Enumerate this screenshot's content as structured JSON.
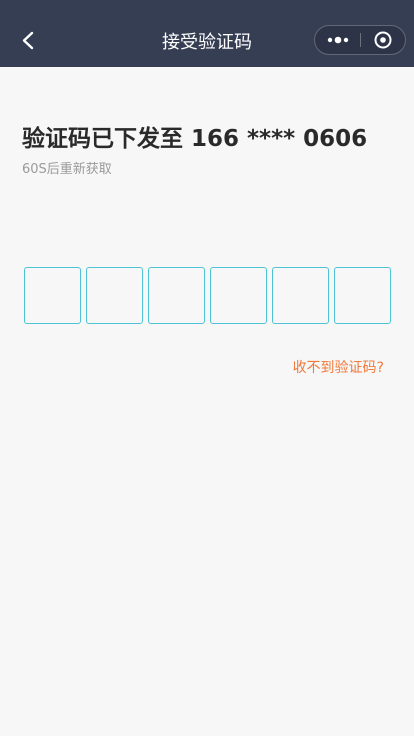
{
  "navbar": {
    "title": "接受验证码",
    "back_icon": "chevron-left-icon",
    "more_icon": "more-dots-icon",
    "close_icon": "target-circle-icon",
    "background_color": "#363e54"
  },
  "main": {
    "headline": "验证码已下发至 166 **** 0606",
    "resend_hint": "60S后重新获取",
    "code_box_count": 6,
    "code_box_border_color": "#4fc3d6",
    "help_link": "收不到验证码?",
    "help_link_color": "#f07a3a"
  }
}
